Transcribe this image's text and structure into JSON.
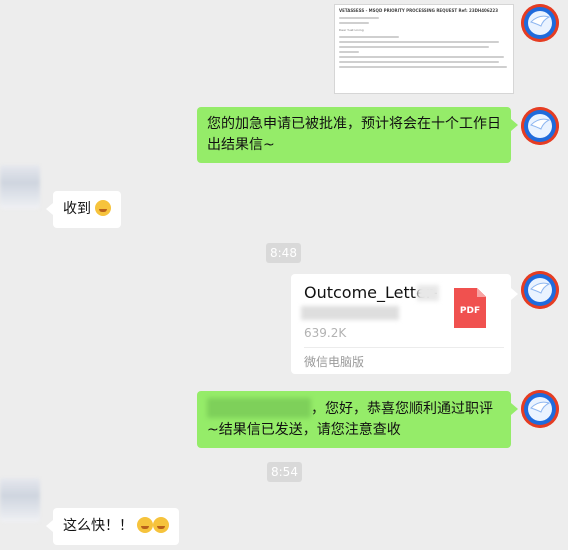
{
  "screenshot": {
    "title": "VETASSESS - MSQD PRIORITY PROCESSING REQUEST Ref: 23DH406223",
    "greeting": "Dear Yuet Lining"
  },
  "messages": {
    "approved_text": "您的加急申请已被批准，预计将会在十个工作日出结果信~",
    "received_text": "收到",
    "time1": "8:48",
    "file_name": "Outcome_Letter-",
    "file_size": "639.2K",
    "file_source": "微信电脑版",
    "file_icon_label": "PDF",
    "congrats_text": "，您好，恭喜您顺利通过职评~结果信已发送，请您注意查收",
    "time2": "8:54",
    "fast_text": "这么快！！"
  },
  "icons": {
    "avatar_right": "bird-logo-icon",
    "avatar_left": "blurred-avatar",
    "pdf": "pdf-file-icon",
    "emoji_smile": "smile-emoji-icon",
    "emoji_hands": "hands-over-mouth-emoji-icon"
  },
  "colors": {
    "background": "#ededed",
    "bubble_green": "#95ec69",
    "bubble_white": "#ffffff",
    "pdf_red": "#f0514f"
  }
}
